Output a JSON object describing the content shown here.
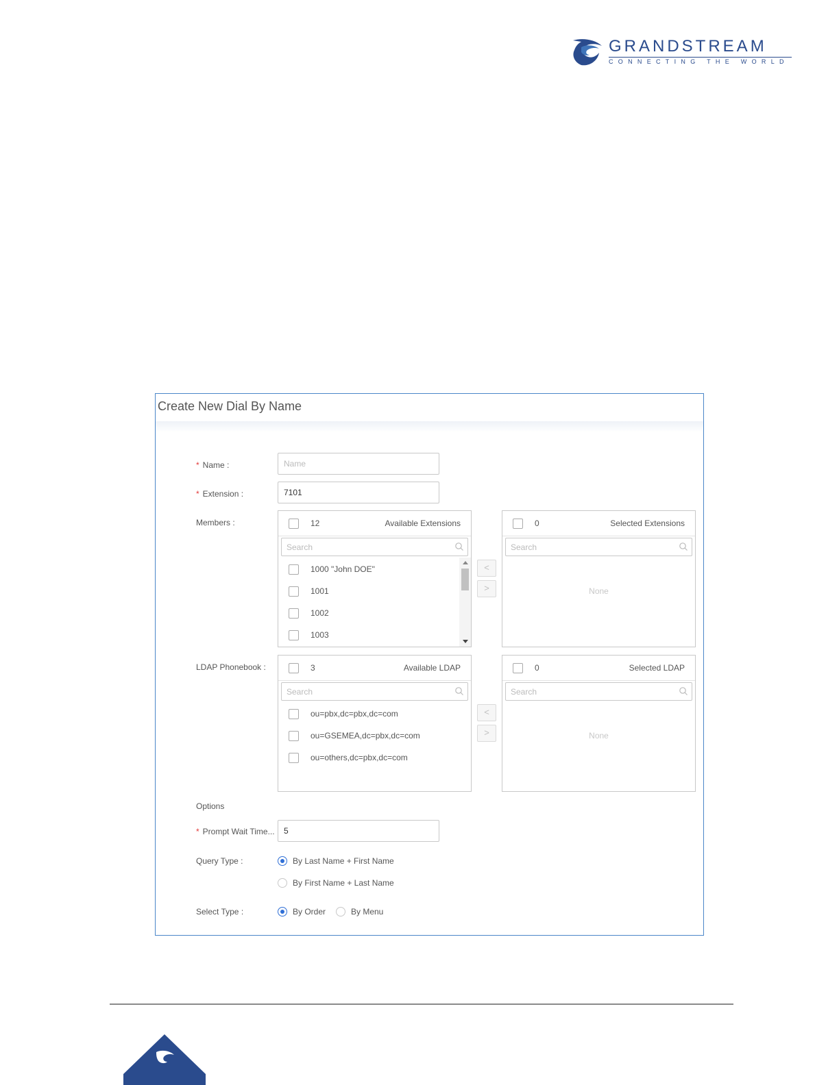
{
  "brand": {
    "name": "GRANDSTREAM",
    "tagline": "CONNECTING THE WORLD",
    "colors": {
      "primary": "#2a4b8d",
      "accent": "#3f74b9"
    }
  },
  "dialog": {
    "title": "Create New Dial By Name",
    "name": {
      "label": "Name",
      "placeholder": "Name",
      "value": ""
    },
    "extension": {
      "label": "Extension",
      "value": "7101"
    },
    "members": {
      "label": "Members",
      "available": {
        "count": "12",
        "title": "Available Extensions",
        "search_placeholder": "Search",
        "items": [
          "1000 \"John DOE\"",
          "1001",
          "1002",
          "1003"
        ]
      },
      "selected": {
        "count": "0",
        "title": "Selected Extensions",
        "search_placeholder": "Search",
        "empty": "None"
      },
      "move_left": "<",
      "move_right": ">"
    },
    "ldap": {
      "label": "LDAP Phonebook",
      "available": {
        "count": "3",
        "title": "Available LDAP",
        "search_placeholder": "Search",
        "items": [
          "ou=pbx,dc=pbx,dc=com",
          "ou=GSEMEA,dc=pbx,dc=com",
          "ou=others,dc=pbx,dc=com"
        ]
      },
      "selected": {
        "count": "0",
        "title": "Selected LDAP",
        "search_placeholder": "Search",
        "empty": "None"
      },
      "move_left": "<",
      "move_right": ">"
    },
    "options": {
      "section_label": "Options",
      "prompt_wait": {
        "label": "Prompt Wait Time...",
        "value": "5"
      },
      "query_type": {
        "label": "Query Type",
        "options": [
          "By Last Name + First Name",
          "By First Name + Last Name"
        ],
        "selected": "By Last Name + First Name"
      },
      "select_type": {
        "label": "Select Type",
        "options": [
          "By Order",
          "By Menu"
        ],
        "selected": "By Order"
      }
    }
  }
}
